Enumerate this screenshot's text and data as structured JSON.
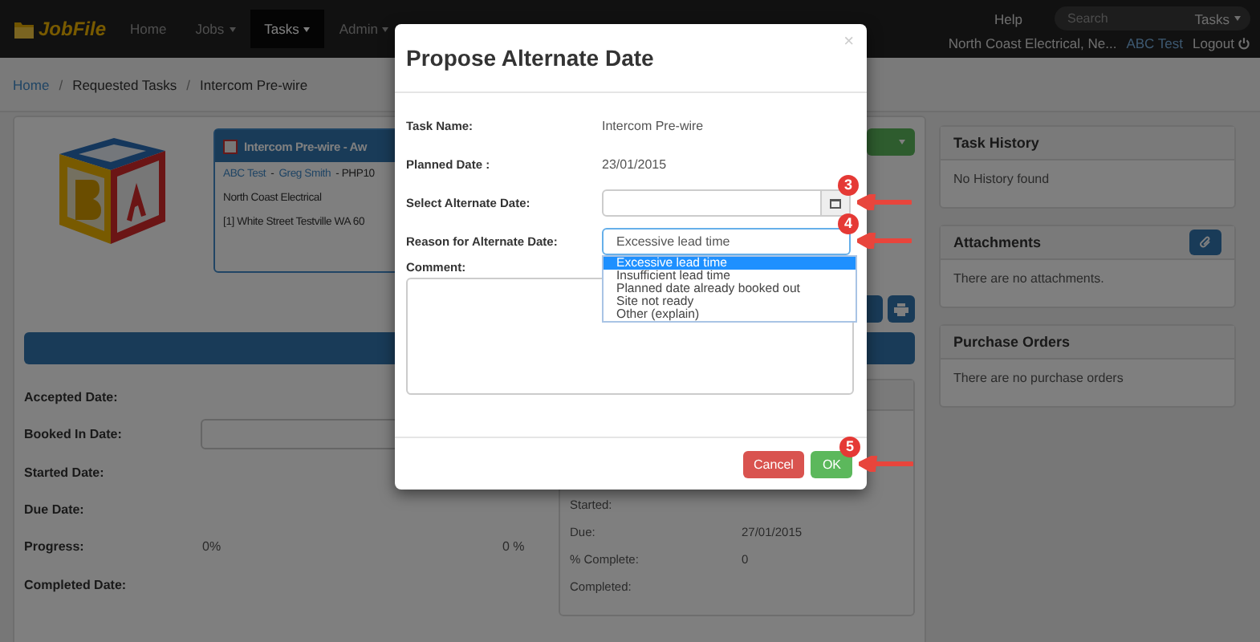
{
  "navbar": {
    "brand": "JobFile",
    "items": [
      {
        "label": "Home",
        "dropdown": false,
        "selected": false
      },
      {
        "label": "Jobs",
        "dropdown": true,
        "selected": false
      },
      {
        "label": "Tasks",
        "dropdown": true,
        "selected": true
      },
      {
        "label": "Admin",
        "dropdown": true,
        "selected": false
      }
    ],
    "help": "Help",
    "search": {
      "placeholder": "Search"
    },
    "search_scope": "Tasks",
    "company": "North Coast Electrical, Ne...",
    "user": "ABC Test",
    "logout": "Logout"
  },
  "breadcrumb": [
    {
      "label": "Home",
      "kind": "link"
    },
    {
      "separator": "/",
      "label": "Requested Tasks",
      "kind": "text"
    },
    {
      "separator": "/",
      "label": "Intercom Pre-wire",
      "kind": "text"
    }
  ],
  "task_card": {
    "title": "Intercom Pre-wire - Aw",
    "contact": [
      {
        "text": "ABC Test",
        "kind": "link"
      },
      {
        "text": "-",
        "kind": "text"
      },
      {
        "text": "Greg Smith",
        "kind": "link"
      },
      {
        "text": "- PHP10",
        "kind": "text"
      }
    ],
    "company": "North Coast Electrical",
    "address": "[1] White Street Testville WA 60"
  },
  "dates": [
    {
      "label": "Accepted Date:",
      "kind": "text"
    },
    {
      "label": "Booked In Date:",
      "kind": "input"
    },
    {
      "label": "Started Date:",
      "kind": "text"
    },
    {
      "label": "Due Date:",
      "kind": "text"
    },
    {
      "label": "Progress:",
      "kind": "text",
      "value": "0%",
      "value_2": "0 %"
    },
    {
      "label": "Completed Date:",
      "kind": "text"
    }
  ],
  "status_panel": {
    "rows": [
      {
        "label": "Started:"
      },
      {
        "label": "Due:",
        "value": "27/01/2015"
      },
      {
        "label": "% Complete:",
        "value": "0"
      },
      {
        "label": "Completed:"
      }
    ]
  },
  "sidebar": [
    {
      "title": "Task History",
      "body": "No History found",
      "has_button": false
    },
    {
      "title": "Attachments",
      "body": "There are no attachments.",
      "has_button": true
    },
    {
      "title": "Purchase Orders",
      "body": "There are no purchase orders",
      "has_button": false
    }
  ],
  "modal": {
    "title": "Propose Alternate Date",
    "close": "×",
    "fields": [
      {
        "kind": "text",
        "label": "Task Name:",
        "value": "Intercom Pre-wire"
      },
      {
        "kind": "text",
        "label": "Planned Date :",
        "value": "23/01/2015"
      },
      {
        "kind": "date",
        "label": "Select Alternate Date:",
        "callout": "3"
      },
      {
        "kind": "select",
        "label": "Reason for Alternate Date:",
        "value": "Excessive lead time",
        "expanded": true,
        "callout": "4",
        "options": [
          {
            "label": "Excessive lead time",
            "selected": true
          },
          {
            "label": "Insufficient lead time",
            "selected": false
          },
          {
            "label": "Planned date already booked out",
            "selected": false
          },
          {
            "label": "Site not ready",
            "selected": false
          },
          {
            "label": "Other (explain)",
            "selected": false
          }
        ]
      },
      {
        "kind": "textarea",
        "label": "Comment:"
      }
    ],
    "buttons": [
      {
        "label": "Cancel",
        "kind": "danger"
      },
      {
        "label": "OK",
        "kind": "success",
        "callout": "5"
      }
    ]
  }
}
